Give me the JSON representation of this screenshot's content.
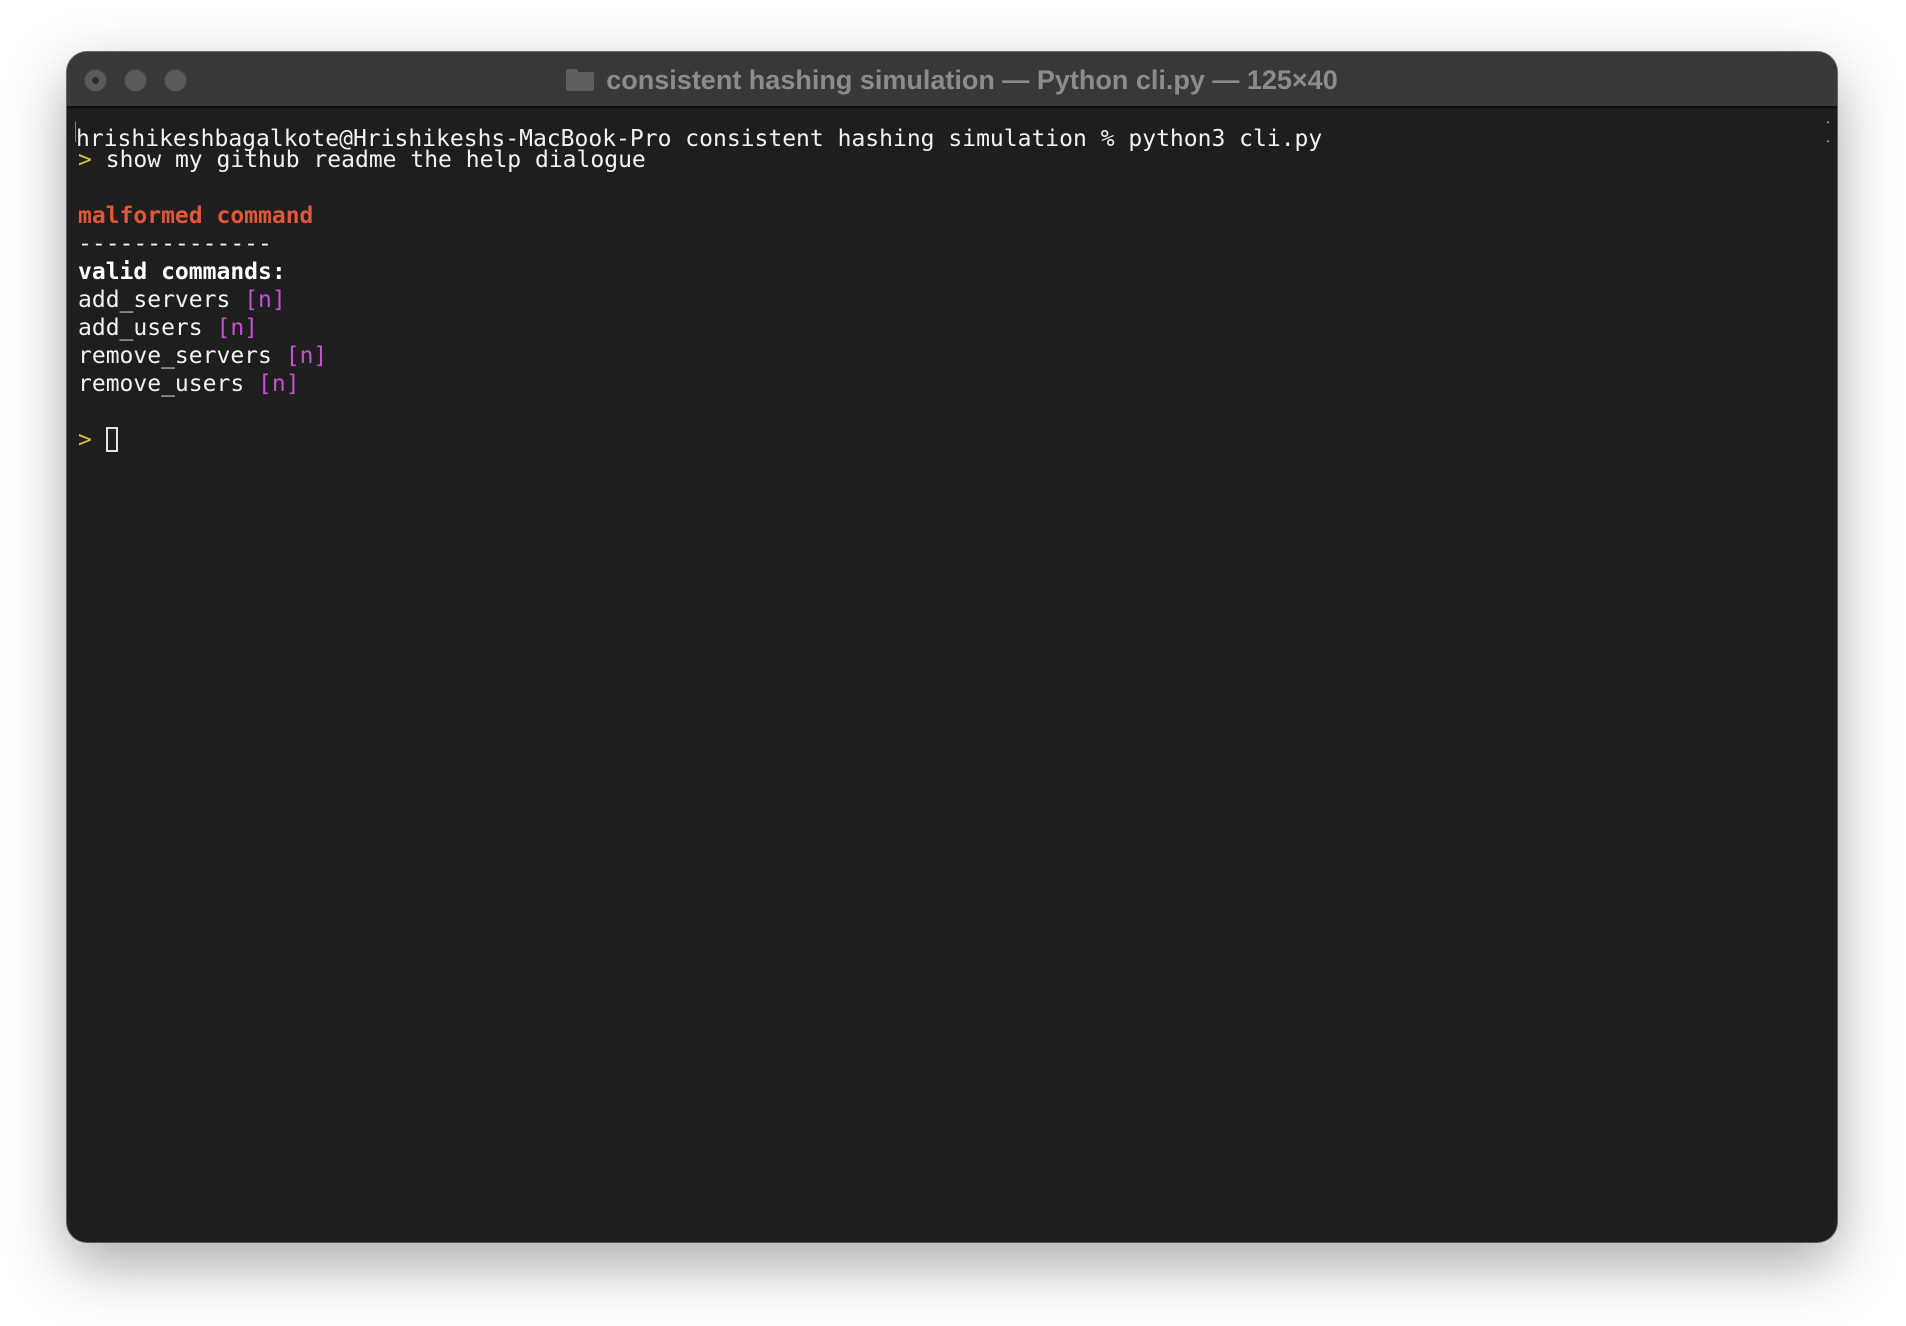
{
  "window": {
    "title": "consistent hashing simulation — Python cli.py — 125×40",
    "icon": "folder-icon"
  },
  "terminal": {
    "shell_line": "hrishikeshbagalkote@Hrishikeshs-MacBook-Pro consistent hashing simulation % python3 cli.py",
    "prompt_symbol": ">",
    "user_input": "show my github readme the help dialogue",
    "error_message": "malformed command",
    "separator": "--------------",
    "valid_heading": "valid commands:",
    "commands": [
      {
        "name": "add_servers",
        "arg": "[n]"
      },
      {
        "name": "add_users",
        "arg": "[n]"
      },
      {
        "name": "remove_servers",
        "arg": "[n]"
      },
      {
        "name": "remove_users",
        "arg": "[n]"
      }
    ],
    "current_input": ""
  },
  "colors": {
    "background": "#1e1e1e",
    "titlebar": "#383838",
    "prompt": "#d6c243",
    "error": "#e0573a",
    "argument": "#c74fd6",
    "text": "#f2f2f2"
  }
}
